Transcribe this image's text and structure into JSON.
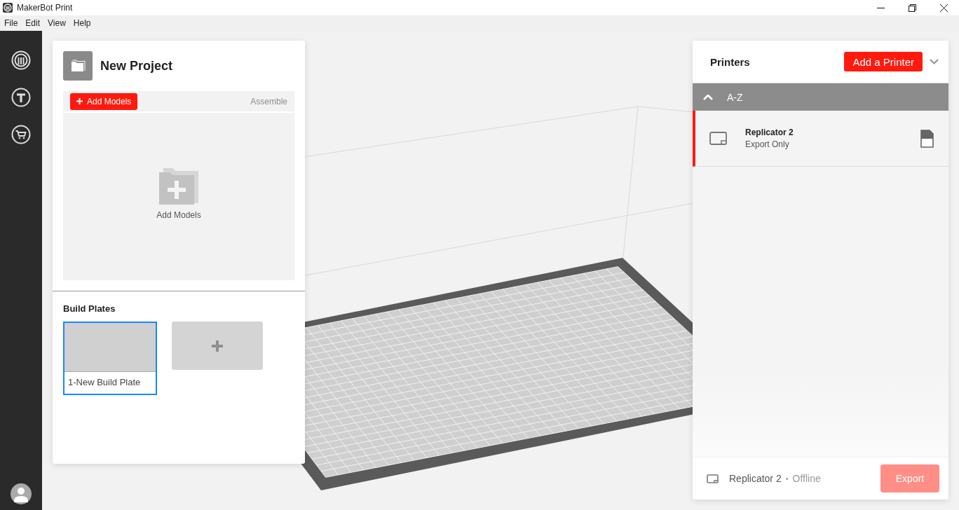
{
  "window": {
    "title": "MakerBot Print"
  },
  "menu": [
    "File",
    "Edit",
    "View",
    "Help"
  ],
  "project": {
    "title": "New Project",
    "add_models_button": "Add Models",
    "assemble": "Assemble",
    "drop_label": "Add Models",
    "build_plates_title": "Build Plates",
    "build_plates": [
      {
        "label": "1-New Build Plate",
        "selected": true
      }
    ]
  },
  "printers_panel": {
    "title": "Printers",
    "add_button": "Add a Printer",
    "group": {
      "label": "A-Z",
      "expanded": true
    },
    "printers": [
      {
        "name": "Replicator 2",
        "status": "Export Only",
        "selected": true
      }
    ],
    "footer": {
      "printer": "Replicator 2",
      "separator": "•",
      "status": "Offline",
      "export_button": "Export",
      "export_disabled": true
    }
  }
}
